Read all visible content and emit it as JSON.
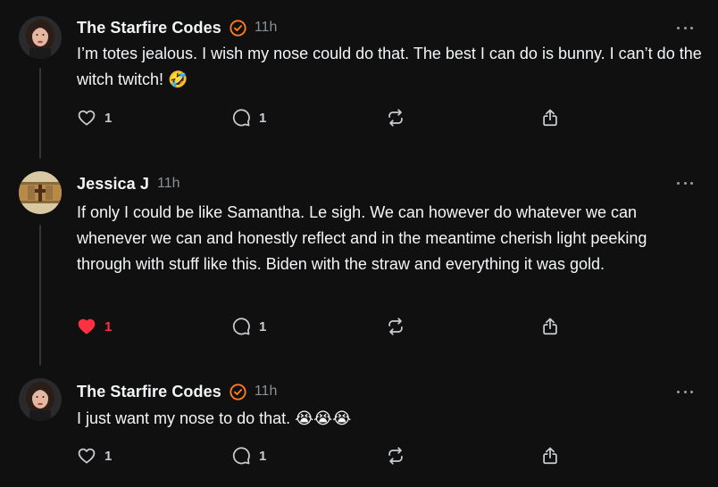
{
  "colors": {
    "background": "#101010",
    "text": "#f3f5f7",
    "muted": "#8b8f94",
    "verified": "#ff7a1a",
    "like": "#ff3040"
  },
  "posts": [
    {
      "username": "The Starfire Codes",
      "verified": true,
      "time": "11h",
      "text": "I’m totes jealous. I wish my nose could do that. The best I can do is bunny. I can’t do the witch twitch! 🤣",
      "liked": false,
      "likes": "1",
      "replies": "1",
      "avatar": "woman-portrait-avatar"
    },
    {
      "username": "Jessica J",
      "verified": false,
      "time": "11h",
      "text": "If only I could be like Samantha. Le sigh. We can however do whatever we can whenever we can and honestly reflect and in the meantime cherish light peeking through with stuff like this. Biden with the straw and everything it was gold.",
      "liked": true,
      "likes": "1",
      "replies": "1",
      "avatar": "wooden-cross-avatar"
    },
    {
      "username": "The Starfire Codes",
      "verified": true,
      "time": "11h",
      "text": "I just want my nose to do that. 😭😭😭",
      "liked": false,
      "likes": "1",
      "replies": "1",
      "avatar": "woman-portrait-avatar"
    }
  ],
  "icons": {
    "like": "heart-icon",
    "reply": "comment-icon",
    "repost": "repost-icon",
    "share": "share-icon",
    "more": "more-options-icon",
    "verified": "verified-badge-icon"
  }
}
